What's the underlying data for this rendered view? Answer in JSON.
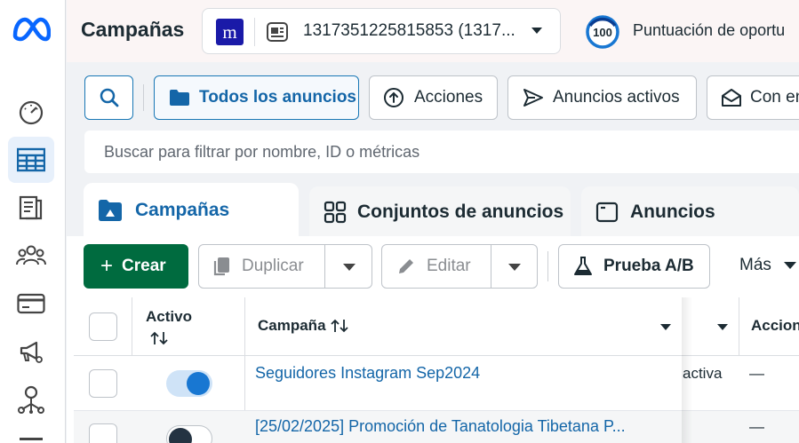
{
  "header": {
    "title": "Campañas",
    "account_logo_letter": "m",
    "account_id": "1317351225815853 (1317...",
    "score": "100",
    "score_label": "Puntuación de oportu"
  },
  "toolbar": {
    "all_ads": "Todos los anuncios",
    "actions": "Acciones",
    "active_ads": "Anuncios activos",
    "con_en": "Con en",
    "filter_placeholder": "Buscar para filtrar por nombre, ID o métricas"
  },
  "tabs": [
    {
      "label": "Campañas"
    },
    {
      "label": "Conjuntos de anuncios"
    },
    {
      "label": "Anuncios"
    }
  ],
  "actions": {
    "create": "Crear",
    "duplicate": "Duplicar",
    "edit": "Editar",
    "ab_test": "Prueba A/B",
    "more": "Más"
  },
  "table": {
    "col_active": "Activo",
    "col_campaign": "Campaña",
    "col_actions": "Accion",
    "rows": [
      {
        "name": "Seguidores Instagram Sep2024",
        "status": "activa",
        "actions": "—",
        "active": true
      },
      {
        "name": "[25/02/2025] Promoción de Tanatologia Tibetana P...",
        "status": "",
        "actions": "—",
        "active": false
      }
    ]
  },
  "colors": {
    "accent": "#1466a8",
    "create": "#006b3f",
    "toggle_on": "#1877d2"
  }
}
